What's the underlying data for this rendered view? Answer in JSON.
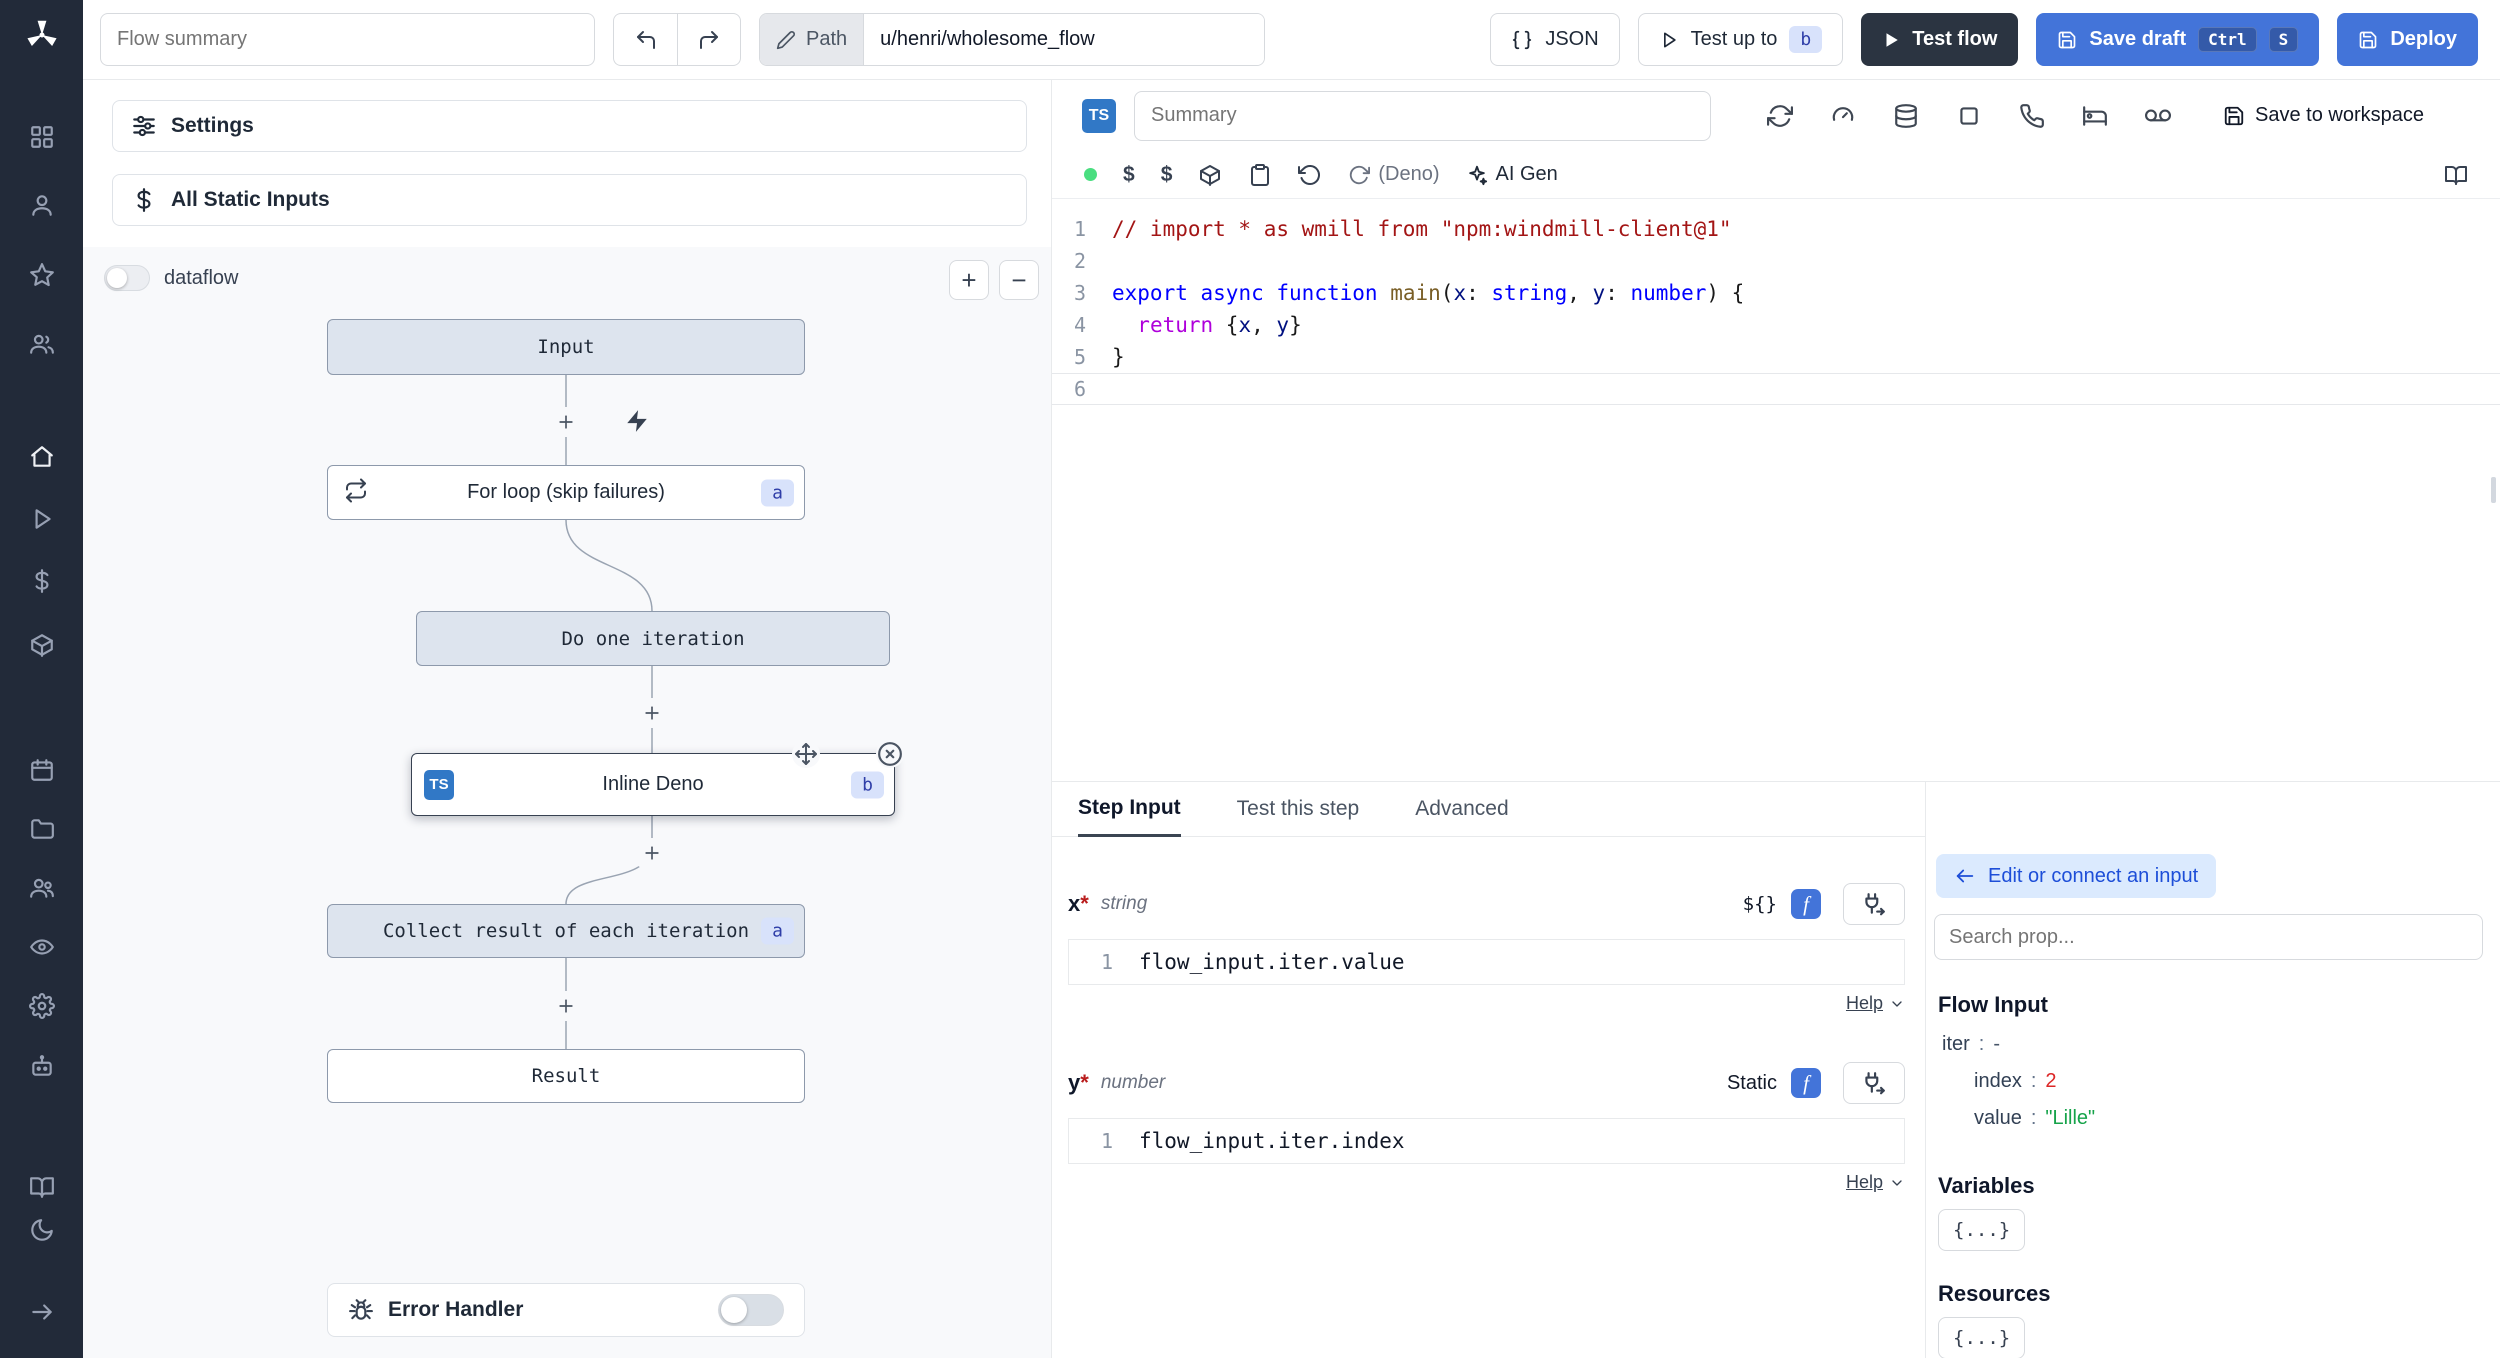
{
  "topbar": {
    "flow_summary_placeholder": "Flow summary",
    "path_label": "Path",
    "path_value": "u/henri/wholesome_flow",
    "json_button": "JSON",
    "test_up_to": "Test up to",
    "test_up_to_badge": "b",
    "test_flow": "Test flow",
    "save_draft": "Save draft",
    "kbd_ctrl": "Ctrl",
    "kbd_s": "S",
    "deploy": "Deploy"
  },
  "sidebar": {
    "icons": [
      "windmill-logo",
      "apps",
      "user",
      "favorites",
      "groups",
      "home",
      "runs",
      "variables",
      "resources",
      "schedules",
      "folders",
      "members",
      "audit-logs",
      "settings",
      "workers",
      "docs",
      "theme-toggle",
      "collapse-sidebar"
    ]
  },
  "flow": {
    "settings": "Settings",
    "static_inputs": "All Static Inputs",
    "dataflow": "dataflow",
    "zoom_in": "+",
    "zoom_out": "−",
    "nodes": {
      "input": {
        "label": "Input"
      },
      "forloop": {
        "label": "For loop (skip failures)",
        "badge": "a"
      },
      "iteration": {
        "label": "Do one iteration"
      },
      "inline": {
        "label": "Inline Deno",
        "badge": "b",
        "lang": "TS"
      },
      "collect": {
        "label": "Collect result of each iteration",
        "badge": "a"
      },
      "result": {
        "label": "Result"
      }
    },
    "error_handler": "Error Handler"
  },
  "editor": {
    "lang_badge": "TS",
    "summary_placeholder": "Summary",
    "save_to_workspace": "Save to workspace",
    "dollar1": "$",
    "dollar2": "$",
    "runtime": "(Deno)",
    "ai_gen": "AI Gen",
    "code_lines": [
      {
        "n": "1",
        "tokens": [
          {
            "c": "cmt",
            "t": "// import * as wmill from \"npm:windmill-client@1\""
          }
        ]
      },
      {
        "n": "2",
        "tokens": []
      },
      {
        "n": "3",
        "tokens": [
          {
            "c": "kw",
            "t": "export"
          },
          {
            "c": "pl",
            "t": " "
          },
          {
            "c": "kw",
            "t": "async"
          },
          {
            "c": "pl",
            "t": " "
          },
          {
            "c": "kw",
            "t": "function"
          },
          {
            "c": "pl",
            "t": " "
          },
          {
            "c": "fn",
            "t": "main"
          },
          {
            "c": "pl",
            "t": "("
          },
          {
            "c": "vr",
            "t": "x"
          },
          {
            "c": "pl",
            "t": ": "
          },
          {
            "c": "kw",
            "t": "string"
          },
          {
            "c": "pl",
            "t": ", "
          },
          {
            "c": "vr",
            "t": "y"
          },
          {
            "c": "pl",
            "t": ": "
          },
          {
            "c": "kw",
            "t": "number"
          },
          {
            "c": "pl",
            "t": ") {"
          }
        ]
      },
      {
        "n": "4",
        "tokens": [
          {
            "c": "pl",
            "t": "  "
          },
          {
            "c": "ctl",
            "t": "return"
          },
          {
            "c": "pl",
            "t": " {"
          },
          {
            "c": "vr",
            "t": "x"
          },
          {
            "c": "pl",
            "t": ", "
          },
          {
            "c": "vr",
            "t": "y"
          },
          {
            "c": "pl",
            "t": "}"
          }
        ]
      },
      {
        "n": "5",
        "tokens": [
          {
            "c": "pl",
            "t": "}"
          }
        ]
      },
      {
        "n": "6",
        "tokens": [],
        "current": true
      }
    ]
  },
  "step_panel": {
    "tabs": [
      "Step Input",
      "Test this step",
      "Advanced"
    ],
    "fn_badge": "f",
    "fields": [
      {
        "name": "x",
        "required": "*",
        "type": "string",
        "mode": "${}",
        "line": "1",
        "expr": "flow_input.iter.value",
        "help": "Help"
      },
      {
        "name": "y",
        "required": "*",
        "type": "number",
        "mode": "Static",
        "line": "1",
        "expr": "flow_input.iter.index",
        "help": "Help"
      }
    ]
  },
  "props": {
    "banner": "Edit or connect an input",
    "search_placeholder": "Search prop...",
    "flow_input_title": "Flow Input",
    "tree": [
      {
        "key": "iter",
        "sep": ":",
        "value": "-"
      },
      {
        "key": "index",
        "sep": ":",
        "value": "2"
      },
      {
        "key": "value",
        "sep": ":",
        "value": "\"Lille\""
      }
    ],
    "variables_title": "Variables",
    "variables_button": "{...}",
    "resources_title": "Resources",
    "resources_button": "{...}"
  }
}
